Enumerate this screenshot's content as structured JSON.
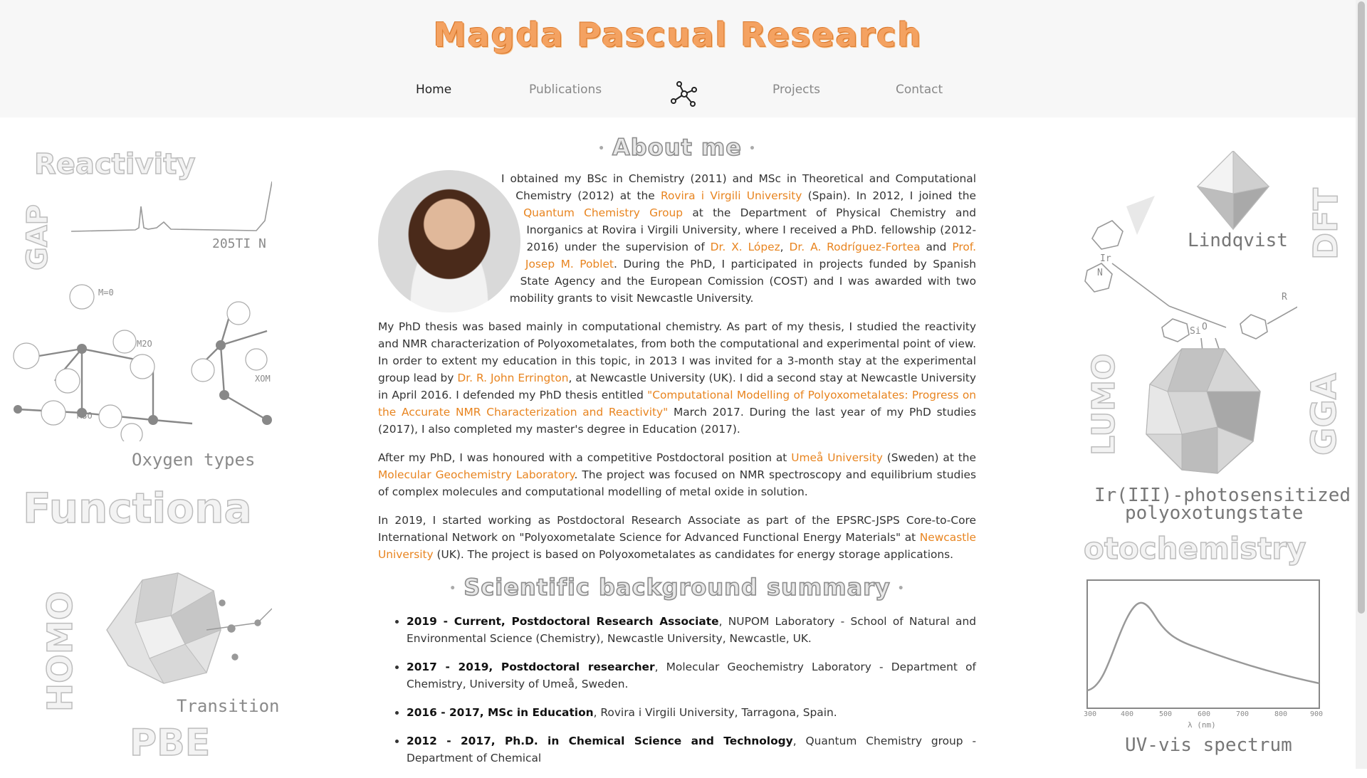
{
  "site": {
    "title": "Magda Pascual Research"
  },
  "nav": {
    "home": "Home",
    "publications": "Publications",
    "logo_icon": "molecule-icon",
    "projects": "Projects",
    "contact": "Contact"
  },
  "about": {
    "title": "About me",
    "p1": {
      "t1": "I obtained my BSc in Chemistry (2011) and MSc in Theoretical and Computational Chemistry (2012) at the ",
      "l1": "Rovira i Virgili University",
      "t2": " (Spain). In 2012, I joined the ",
      "l2": "Quantum Chemistry Group",
      "t3": " at the Department of Physical Chemistry and Inorganics at Rovira i Virgili University, where I received a PhD. fellowship (2012-2016) under the supervision of ",
      "l3": "Dr. X. López",
      "t4": ", ",
      "l4": "Dr. A. Rodríguez-Fortea",
      "t5": " and ",
      "l5": "Prof. Josep M. Poblet",
      "t6": ". During the PhD, I participated in projects funded by Spanish State Agency and the European Comission (COST) and I was awarded with two mobility grants to visit Newcastle University."
    },
    "p2": {
      "t1": "My PhD thesis was based mainly in computational chemistry. As part of my thesis, I studied the reactivity and NMR characterization of Polyoxometalates, from both the computational and experimental point of view. In order to extent my education in this topic, in 2013 I was invited for a 3-month stay at the experimental group lead by ",
      "l1": "Dr. R. John Errington",
      "t2": ", at Newcastle University (UK). I did a second stay at Newcastle University in April 2016. I defended my PhD thesis entitled ",
      "l2": "\"Computational Modelling of Polyoxometalates: Progress on the Accurate NMR Characterization and Reactivity\"",
      "t3": " March 2017. During the last year of my PhD studies (2017), I also completed my master's degree in Education (2017)."
    },
    "p3": {
      "t1": "After my PhD, I was honoured with a competitive Postdoctoral position at ",
      "l1": "Umeå University",
      "t2": " (Sweden) at the ",
      "l2": "Molecular Geochemistry Laboratory",
      "t3": ". The project was focused on NMR spectroscopy and equilibrium studies of complex molecules and computational modelling of metal oxide in solution."
    },
    "p4": {
      "t1": "In 2019, I started working as Postdoctoral Research Associate as part of the EPSRC-JSPS Core-to-Core International Network on \"Polyoxometalate Science for Advanced Functional Energy Materials\" at ",
      "l1": "Newcastle University",
      "t2": " (UK). The project is based on Polyoxometalates as candidates for energy storage applications."
    }
  },
  "background": {
    "title": "Scientific background summary",
    "items": [
      {
        "bold": "2019 - Current, Postdoctoral Research Associate",
        "rest": ", NUPOM Laboratory - School of Natural and Environmental Science (Chemistry), Newcastle University, Newcastle, UK."
      },
      {
        "bold": "2017 - 2019, Postdoctoral researcher",
        "rest": ", Molecular Geochemistry Laboratory - Department of Chemistry, University of Umeå, Sweden."
      },
      {
        "bold": "2016 - 2017, MSc in Education",
        "rest": ", Rovira i Virgili University, Tarragona, Spain."
      },
      {
        "bold": "2012 - 2017, Ph.D. in Chemical Science and Technology",
        "rest": ", Quantum Chemistry group - Department of Chemical"
      }
    ]
  },
  "left_art": {
    "reactivity": "Reactivity",
    "gap": "GAP",
    "oxygen_types": "Oxygen types",
    "functional": "Functiona",
    "homo": "HOMO",
    "transition": "Transition",
    "pbe": "PBE",
    "spectrum_label": "205TI N",
    "m0": "M=0",
    "m2o": "M2O",
    "m3o": "M3O",
    "xom": "XOM"
  },
  "right_art": {
    "dft": "DFT",
    "lindqvist": "Lindqvist",
    "lumo": "LUMO",
    "gga": "GGA",
    "complex_line1": "Ir(III)-photosensitized",
    "complex_line2": "polyoxotungstate",
    "photochemistry": "otochemistry",
    "uvvis": "UV-vis spectrum",
    "axis_label": "λ (nm)",
    "ticks": [
      "300",
      "400",
      "500",
      "600",
      "700",
      "800",
      "900"
    ],
    "r_label": "R",
    "si_label": "Si",
    "o_label": "O",
    "ir_label": "Ir",
    "n_label": "N"
  }
}
